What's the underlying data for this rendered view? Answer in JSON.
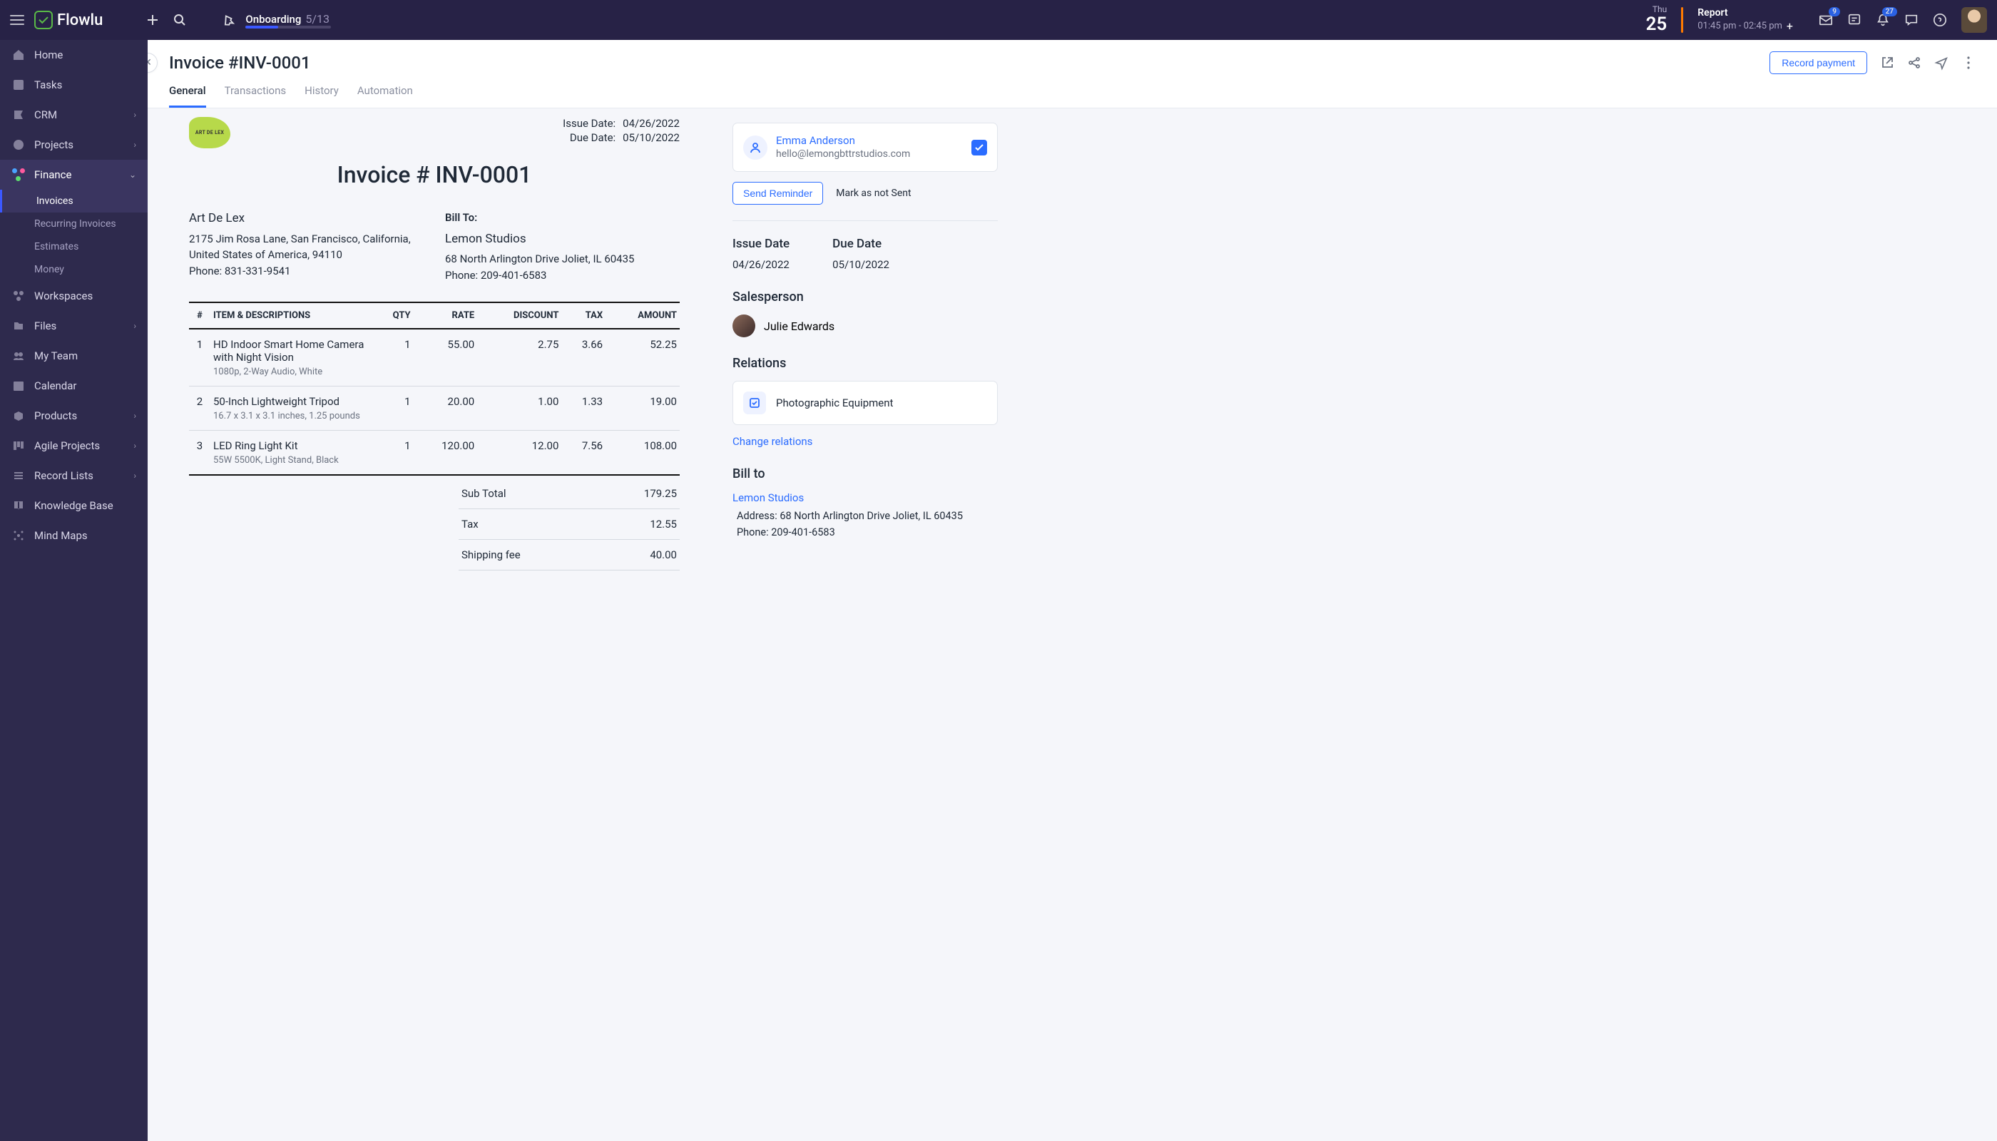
{
  "app": {
    "name": "Flowlu"
  },
  "onboarding": {
    "label": "Onboarding",
    "count": "5/13"
  },
  "datetime": {
    "weekday": "Thu",
    "day": "25"
  },
  "report": {
    "title": "Report",
    "time": "01:45 pm - 02:45 pm"
  },
  "badges": {
    "mail": "9",
    "bell": "27"
  },
  "sidebar": {
    "items": [
      {
        "label": "Home"
      },
      {
        "label": "Tasks"
      },
      {
        "label": "CRM"
      },
      {
        "label": "Projects"
      },
      {
        "label": "Finance"
      },
      {
        "label": "Workspaces"
      },
      {
        "label": "Files"
      },
      {
        "label": "My Team"
      },
      {
        "label": "Calendar"
      },
      {
        "label": "Products"
      },
      {
        "label": "Agile Projects"
      },
      {
        "label": "Record Lists"
      },
      {
        "label": "Knowledge Base"
      },
      {
        "label": "Mind Maps"
      }
    ],
    "finance_subs": [
      {
        "label": "Invoices"
      },
      {
        "label": "Recurring Invoices"
      },
      {
        "label": "Estimates"
      },
      {
        "label": "Money"
      }
    ]
  },
  "page": {
    "title": "Invoice #INV-0001",
    "record_payment": "Record payment",
    "tabs": [
      "General",
      "Transactions",
      "History",
      "Automation"
    ]
  },
  "invoice": {
    "logo_text": "ART DE LEX",
    "issue_date_label": "Issue Date:",
    "issue_date": "04/26/2022",
    "due_date_label": "Due Date:",
    "due_date": "05/10/2022",
    "heading": "Invoice # INV-0001",
    "from": {
      "name": "Art De Lex",
      "addr": "2175 Jim Rosa Lane, San Francisco, California, United States of America, 94110",
      "phone": "Phone: 831-331-9541"
    },
    "to": {
      "label": "Bill To:",
      "name": "Lemon Studios",
      "addr": "68 North Arlington Drive Joliet, IL 60435",
      "phone": "Phone: 209-401-6583"
    },
    "cols": {
      "num": "#",
      "item": "ITEM & DESCRIPTIONS",
      "qty": "QTY",
      "rate": "RATE",
      "discount": "DISCOUNT",
      "tax": "TAX",
      "amount": "AMOUNT"
    },
    "rows": [
      {
        "n": "1",
        "name": "HD Indoor Smart Home Camera with Night Vision",
        "desc": "1080p, 2-Way Audio, White",
        "qty": "1",
        "rate": "55.00",
        "discount": "2.75",
        "tax": "3.66",
        "amount": "52.25"
      },
      {
        "n": "2",
        "name": "50-Inch Lightweight Tripod",
        "desc": "16.7 x 3.1 x 3.1 inches, 1.25 pounds",
        "qty": "1",
        "rate": "20.00",
        "discount": "1.00",
        "tax": "1.33",
        "amount": "19.00"
      },
      {
        "n": "3",
        "name": "LED Ring Light Kit",
        "desc": "55W 5500K, Light Stand, Black",
        "qty": "1",
        "rate": "120.00",
        "discount": "12.00",
        "tax": "7.56",
        "amount": "108.00"
      }
    ],
    "totals": {
      "subtotal_label": "Sub Total",
      "subtotal": "179.25",
      "tax_label": "Tax",
      "tax": "12.55",
      "shipping_label": "Shipping fee",
      "shipping": "40.00"
    }
  },
  "rightcol": {
    "contact": {
      "name": "Emma Anderson",
      "email": "hello@lemongbttrstudios.com"
    },
    "send_reminder": "Send Reminder",
    "mark_not_sent": "Mark as not Sent",
    "issue_date_label": "Issue Date",
    "issue_date": "04/26/2022",
    "due_date_label": "Due Date",
    "due_date": "05/10/2022",
    "salesperson_label": "Salesperson",
    "salesperson": "Julie Edwards",
    "relations_label": "Relations",
    "relation": "Photographic Equipment",
    "change_relations": "Change relations",
    "billto_label": "Bill to",
    "billto_company": "Lemon Studios",
    "billto_address": "Address: 68 North Arlington Drive Joliet, IL 60435",
    "billto_phone": "Phone: 209-401-6583"
  }
}
